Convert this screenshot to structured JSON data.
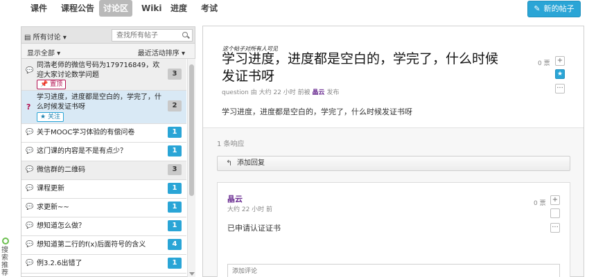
{
  "nav": {
    "tabs": [
      "课件",
      "课程公告",
      "讨论区",
      "Wiki",
      "进度",
      "考试"
    ],
    "active_tab": "讨论区",
    "new_post_label": "新的帖子"
  },
  "side_widget": {
    "label": "搜索推荐"
  },
  "left": {
    "filter_label": "所有讨论",
    "search_placeholder": "查找所有帖子",
    "show_label": "显示全部",
    "sort_label": "最近活动排序",
    "threads": [
      {
        "title": "同浩老师的微信号码为179716849，欢迎大家讨论数学问题",
        "count": "3",
        "badge": "gray",
        "tag": "置顶",
        "icon": "comment"
      },
      {
        "title": "学习进度，进度都是空白的，学完了，什么时候发证书呀",
        "count": "2",
        "badge": "gray",
        "tag": "关注",
        "icon": "question"
      },
      {
        "title": "关于MOOC学习体验的有偿问卷",
        "count": "1",
        "badge": "blue",
        "icon": "comment"
      },
      {
        "title": "这门课的内容是不是有点少？",
        "count": "1",
        "badge": "blue",
        "icon": "comment"
      },
      {
        "title": "微信群的二维码",
        "count": "3",
        "badge": "gray",
        "icon": "comment"
      },
      {
        "title": "课程更新",
        "count": "1",
        "badge": "blue",
        "icon": "comment"
      },
      {
        "title": "求更新~~",
        "count": "1",
        "badge": "blue",
        "icon": "comment"
      },
      {
        "title": "想知道怎么做？",
        "count": "1",
        "badge": "blue",
        "icon": "comment"
      },
      {
        "title": "想知道第二行的f(x)后面符号的含义",
        "count": "4",
        "badge": "blue",
        "icon": "comment"
      },
      {
        "title": "例3.2.6出错了",
        "count": "1",
        "badge": "blue",
        "icon": "comment"
      }
    ]
  },
  "post": {
    "visibility_hint": "这个帖子对所有人可见",
    "title": "学习进度，进度都是空白的，学完了，什么时候发证书呀",
    "meta_type": "question",
    "meta_time": "由 大约 22 小时 前被",
    "author": "晶云",
    "meta_suffix": "发布",
    "body": "学习进度，进度都是空白的，学完了，什么时候发证书呀",
    "votes": "0 票"
  },
  "responses": {
    "count_label": "1 条响应",
    "add_reply_label": "添加回复",
    "items": [
      {
        "author": "晶云",
        "time": "大约 22 小时 前",
        "body": "已申请认证证书",
        "votes": "0 票",
        "comment_placeholder": "添加评论"
      }
    ]
  },
  "colors": {
    "accent": "#2aa5d6",
    "tag_pin": "#b20f4f",
    "author": "#6a2c91"
  }
}
